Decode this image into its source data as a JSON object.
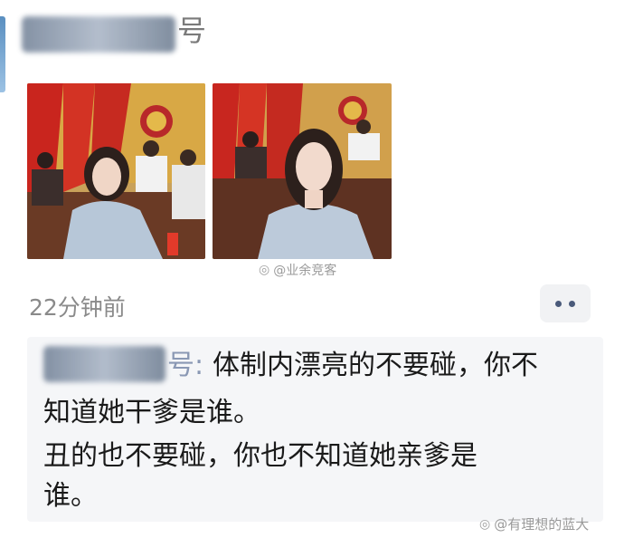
{
  "post": {
    "author_suffix": "号",
    "timestamp": "22分钟前",
    "watermark_top": "@业余竞客",
    "photos": [
      "photo-conference-left",
      "photo-conference-right"
    ]
  },
  "comment": {
    "author_suffix": "号:",
    "lines": [
      "体制内漂亮的不要碰，你不",
      "知道她干爹是谁。",
      "丑的也不要碰，你也不知道她亲爹是",
      "谁。"
    ]
  },
  "watermark_bottom": "@有理想的蓝大",
  "icons": {
    "more": "more-dots-icon",
    "weibo": "weibo-icon"
  }
}
